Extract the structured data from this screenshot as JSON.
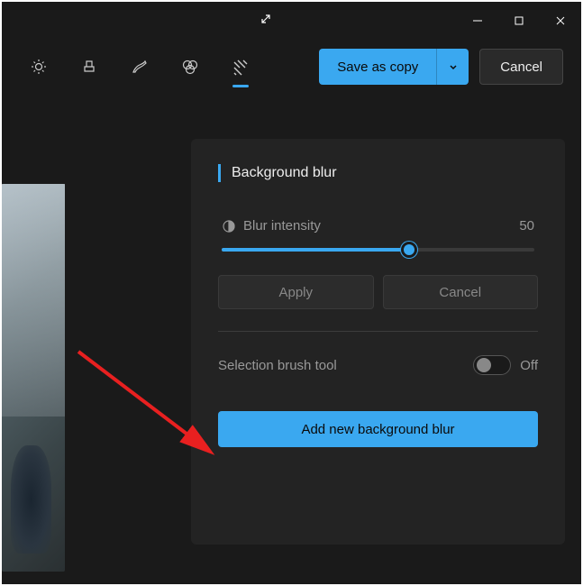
{
  "titlebar": {
    "expand_icon": "expand-diagonal"
  },
  "toolbar": {
    "save_label": "Save as copy",
    "cancel_label": "Cancel"
  },
  "panel": {
    "title": "Background blur",
    "intensity_label": "Blur intensity",
    "intensity_value": "50",
    "apply_label": "Apply",
    "cancel_label": "Cancel",
    "brush_label": "Selection brush tool",
    "toggle_state": "Off",
    "add_label": "Add new background blur"
  },
  "colors": {
    "accent": "#3aa8f0",
    "bg": "#1a1a1a",
    "panel_bg": "#232323"
  }
}
